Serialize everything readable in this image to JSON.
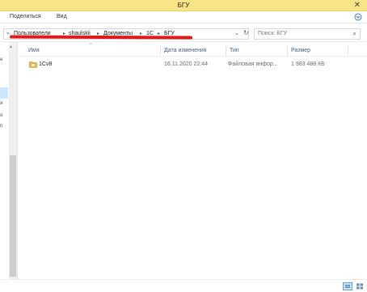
{
  "window": {
    "title": "БГУ",
    "close_glyph": "✕"
  },
  "ribbon": {
    "tabs": [
      {
        "label": "Поделиться"
      },
      {
        "label": "Вид"
      }
    ],
    "toggle_glyph": "⌄"
  },
  "address": {
    "overflow": "«",
    "crumbs": [
      "Пользователи",
      "shaulskii",
      "Документы",
      "1С",
      "БГУ"
    ],
    "separator": "▸",
    "dropdown_glyph": "⌄",
    "refresh_glyph": "↻",
    "annotation_color": "#e01a1a"
  },
  "search": {
    "placeholder": "Поиск: БГУ",
    "icon_glyph": "⌕"
  },
  "navpane": {
    "fragments": [
      "е",
      "я",
      "о",
      "п"
    ]
  },
  "columns": {
    "name": "Имя",
    "date": "Дата изменения",
    "type": "Тип",
    "size": "Размер",
    "sort_glyph": "^"
  },
  "files": [
    {
      "name": "1Cv8",
      "date": "16.11.2020 22:44",
      "type": "Файловая инфор...",
      "size": "1 983 488 КБ",
      "icon": "folder-icon"
    }
  ],
  "colors": {
    "titlebar": "#f9e486",
    "folder": "#e8b84a",
    "selection": "#cce8ff"
  }
}
